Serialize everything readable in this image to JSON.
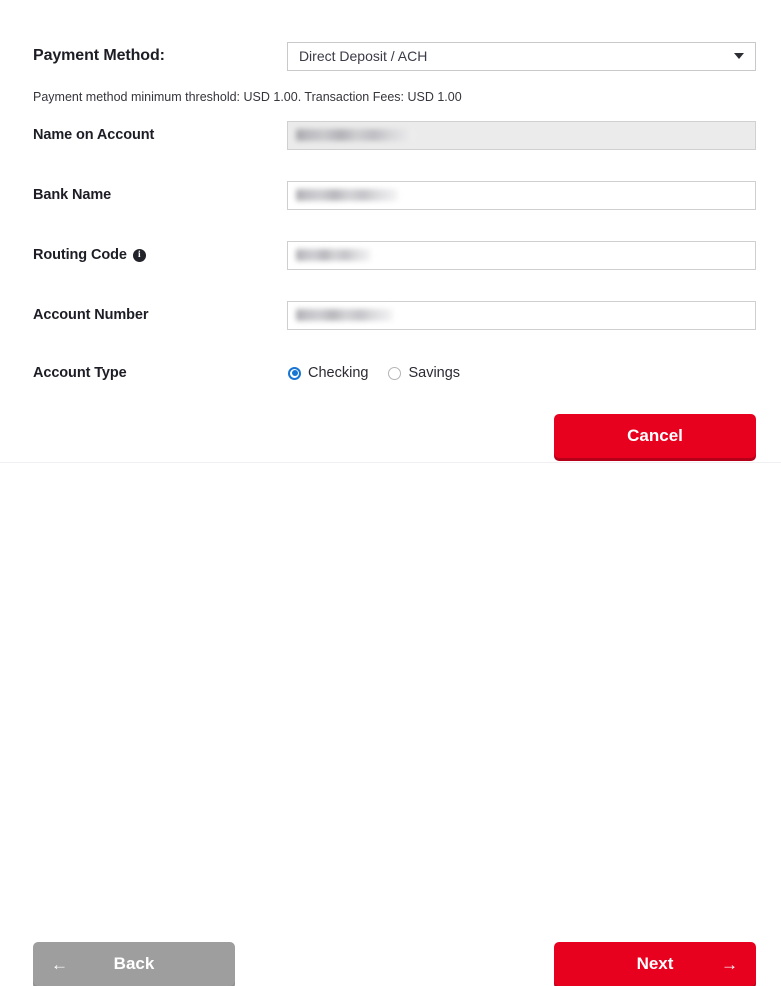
{
  "form": {
    "payment_method": {
      "label": "Payment Method:",
      "selected_option": "Direct Deposit / ACH",
      "chevron_icon": "chevron-down-icon"
    },
    "threshold_note": "Payment method minimum threshold: USD 1.00. Transaction Fees: USD 1.00",
    "fields": [
      {
        "label": "Name on Account",
        "value": "",
        "redacted": true,
        "disabled": true
      },
      {
        "label": "Bank Name",
        "value": "",
        "redacted": true,
        "disabled": false
      },
      {
        "label": "Routing Code",
        "value": "",
        "redacted": true,
        "disabled": false,
        "info_icon": "info-icon",
        "info_glyph": "i"
      },
      {
        "label": "Account Number",
        "value": "",
        "redacted": true,
        "disabled": false
      }
    ],
    "account_type": {
      "label": "Account Type",
      "options": [
        {
          "label": "Checking",
          "selected": true
        },
        {
          "label": "Savings",
          "selected": false
        }
      ]
    }
  },
  "buttons": {
    "cancel": {
      "label": "Cancel"
    },
    "next": {
      "label": "Next",
      "arrow_icon": "arrow-right-icon",
      "arrow_glyph": "→"
    },
    "back": {
      "label": "Back",
      "arrow_icon": "arrow-left-icon",
      "arrow_glyph": "←"
    }
  },
  "colors": {
    "accent_red": "#E8001F",
    "accent_red_shadow": "#B50019",
    "gray_button": "#9E9E9E",
    "radio_blue": "#1876D2",
    "disabled_field": "#EBEBEB"
  }
}
